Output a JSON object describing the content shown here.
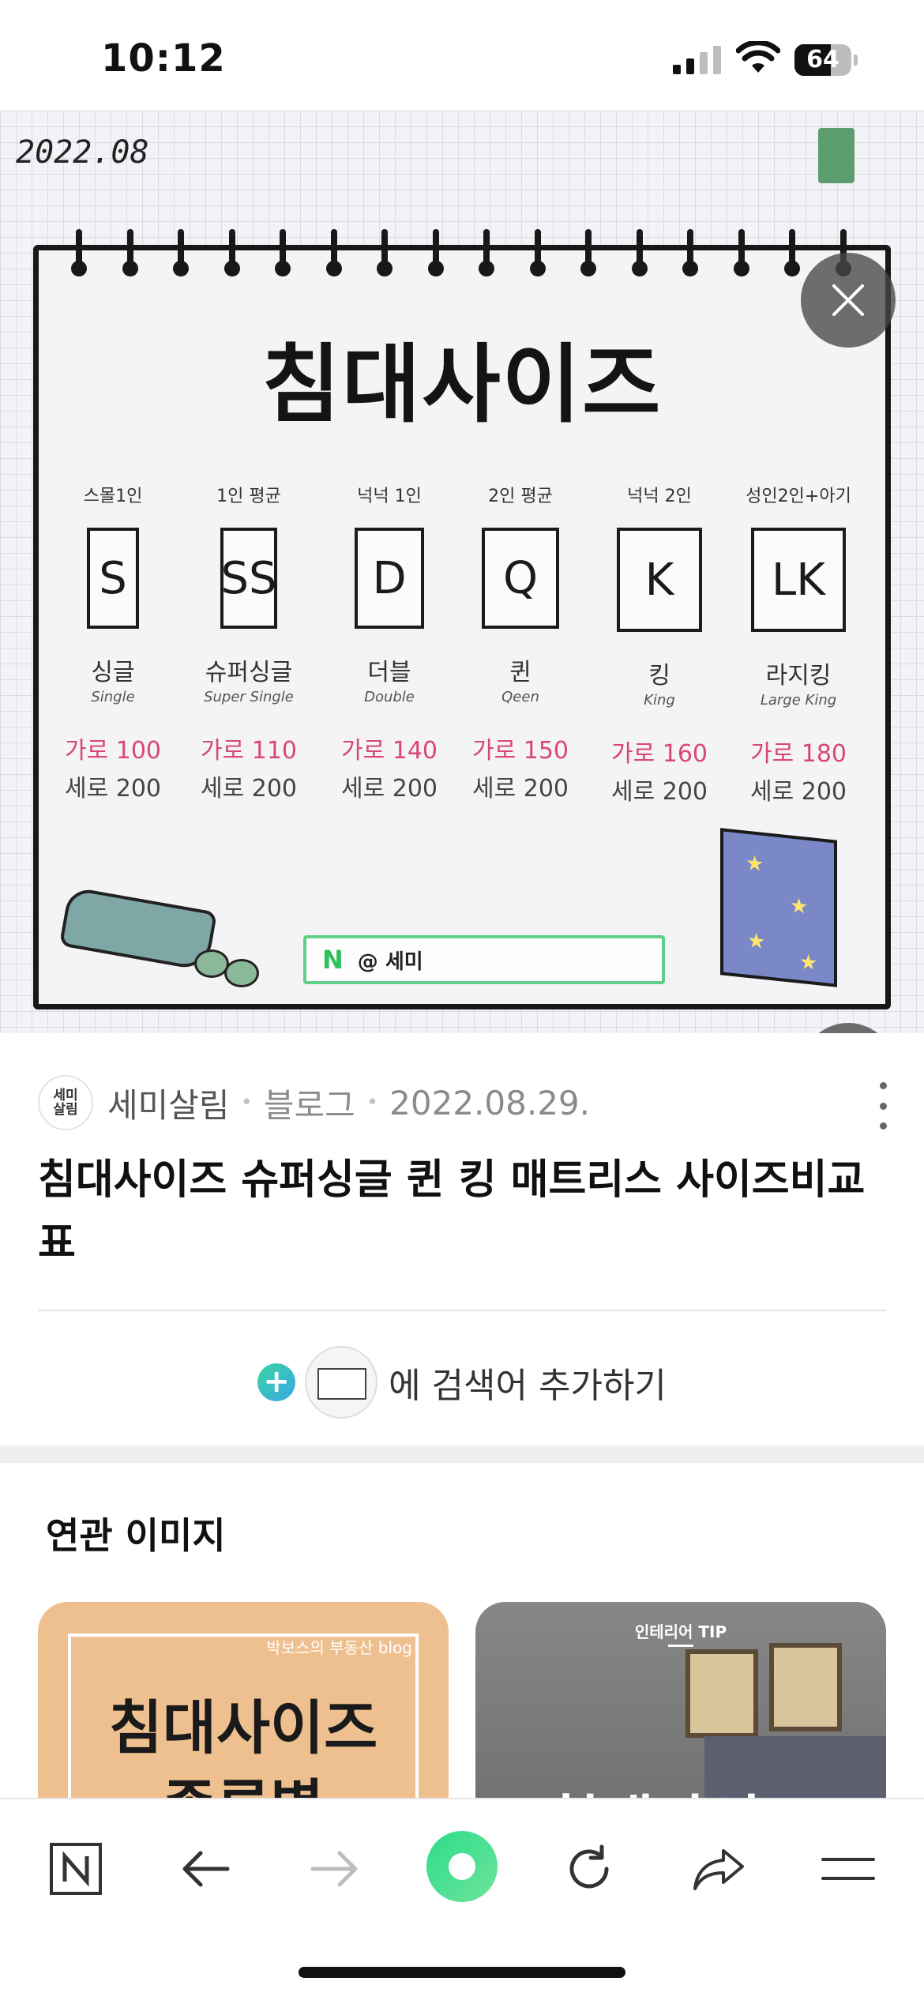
{
  "status_bar": {
    "time": "10:12",
    "battery": "64",
    "battery_level": 0.64
  },
  "image": {
    "date_stamp": "2022.08",
    "title": "침대사이즈",
    "sizes": [
      {
        "caption": "스몰1인",
        "code": "S",
        "ko": "싱글",
        "en": "Single",
        "width": "가로 100",
        "length": "세로 200"
      },
      {
        "caption": "1인 평균",
        "code": "SS",
        "ko": "슈퍼싱글",
        "en": "Super Single",
        "width": "가로 110",
        "length": "세로 200"
      },
      {
        "caption": "넉넉 1인",
        "code": "D",
        "ko": "더블",
        "en": "Double",
        "width": "가로 140",
        "length": "세로 200"
      },
      {
        "caption": "2인 평균",
        "code": "Q",
        "ko": "퀸",
        "en": "Qeen",
        "width": "가로 150",
        "length": "세로 200"
      },
      {
        "caption": "넉넉 2인",
        "code": "K",
        "ko": "킹",
        "en": "King",
        "width": "가로 160",
        "length": "세로 200"
      },
      {
        "caption": "성인2인+아기",
        "code": "LK",
        "ko": "라지킹",
        "en": "Large King",
        "width": "가로 180",
        "length": "세로 200"
      }
    ],
    "handle_n": "N",
    "handle": "@ 세미"
  },
  "info": {
    "blog_avatar_text": "세미\n살림",
    "source_name": "세미살림",
    "source_type": "블로그",
    "date": "2022.08.29.",
    "title": "침대사이즈 슈퍼싱글 퀸 킹 매트리스 사이즈비교표",
    "add_search_label": "에 검색어 추가하기"
  },
  "related": {
    "heading": "연관 이미지",
    "card1": {
      "subtitle": "박보스의 부동산 blog",
      "title_line1": "침대사이즈",
      "title_line2": "종류별"
    },
    "card2": {
      "tag": "인테리어 TIP",
      "title": "침대사이즈"
    }
  },
  "colors": {
    "accent_pink": "#d9467a",
    "naver_green": "#2fbf5b"
  }
}
